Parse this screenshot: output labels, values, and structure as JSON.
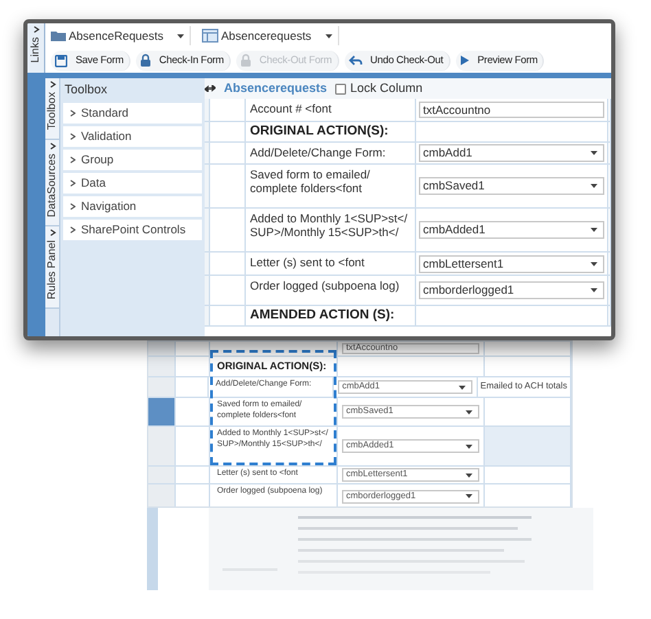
{
  "side_tabs": [
    {
      "label": "Links"
    }
  ],
  "breadcrumbs": [
    {
      "label": "AbsenceRequests",
      "kind": "folder"
    },
    {
      "label": "Absencerequests",
      "kind": "list"
    }
  ],
  "toolbar": [
    {
      "label": "Save Form",
      "kind": "save",
      "disabled": false
    },
    {
      "label": "Check-In Form",
      "kind": "lock",
      "disabled": false
    },
    {
      "label": "Check-Out Form",
      "kind": "lock",
      "disabled": true
    },
    {
      "label": "Undo Check-Out",
      "kind": "undo",
      "disabled": false
    },
    {
      "label": "Preview Form",
      "kind": "play",
      "disabled": false
    }
  ],
  "panel_tabs": [
    {
      "label": "Toolbox"
    },
    {
      "label": "DataSources"
    },
    {
      "label": "Rules Panel"
    }
  ],
  "toolbox": {
    "title": "Toolbox",
    "items": [
      "Standard",
      "Validation",
      "Group",
      "Data",
      "Navigation",
      "SharePoint Controls"
    ]
  },
  "form": {
    "title": "Absencerequests",
    "lock_column": {
      "label": "Lock Column",
      "checked": false
    },
    "rows": [
      {
        "kind": "field",
        "label": "Account # <font",
        "value": "txtAccountno"
      },
      {
        "kind": "heading",
        "label": "ORIGINAL ACTION(S):"
      },
      {
        "kind": "dropdown",
        "label": "Add/Delete/Change Form:",
        "value": "cmbAdd1"
      },
      {
        "kind": "dropdown",
        "label": "Saved form to emailed/ complete folders<font",
        "value": "cmbSaved1"
      },
      {
        "kind": "dropdown",
        "label": "Added to Monthly 1<SUP>st</ SUP>/Monthly 15<SUP>th</",
        "value": "cmbAdded1"
      },
      {
        "kind": "dropdown",
        "label": "Letter (s) sent to <font",
        "value": "cmbLettersent1"
      },
      {
        "kind": "dropdown",
        "label": "Order logged (subpoena log)",
        "value": "cmborderlogged1"
      },
      {
        "kind": "heading",
        "label": "AMENDED ACTION (S):"
      }
    ]
  },
  "background_form": {
    "rows": [
      {
        "kind": "field",
        "value": "txtAccountno"
      },
      {
        "kind": "heading",
        "label": "ORIGINAL ACTION(S):"
      },
      {
        "kind": "dropdown",
        "label": "Add/Delete/Change Form:",
        "value": "cmbAdd1",
        "note": "Emailed to ACH totals"
      },
      {
        "kind": "dropdown",
        "label": "Saved form to emailed/ complete folders<font",
        "value": "cmbSaved1"
      },
      {
        "kind": "dropdown",
        "label": "Added to Monthly 1<SUP>st</ SUP>/Monthly 15<SUP>th</",
        "value": "cmbAdded1"
      },
      {
        "kind": "dropdown",
        "label": "Letter (s) sent to <font",
        "value": "cmbLettersent1"
      },
      {
        "kind": "dropdown",
        "label": "Order logged (subpoena log)",
        "value": "cmborderlogged1"
      }
    ]
  }
}
